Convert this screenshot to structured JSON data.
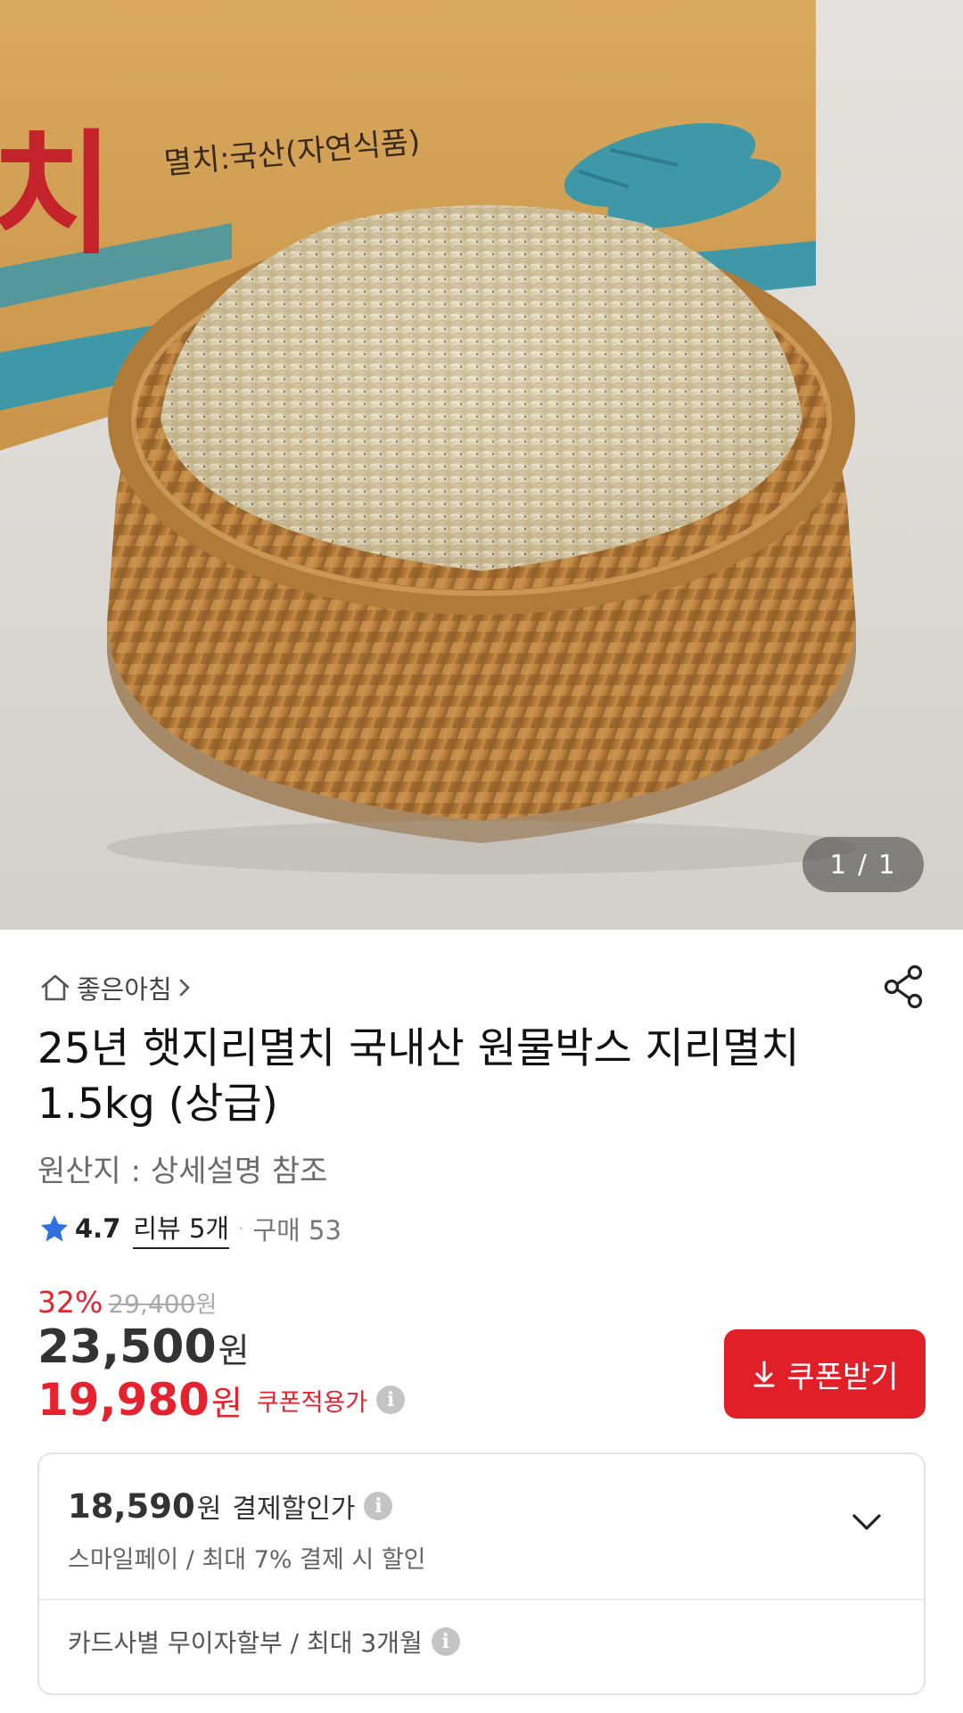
{
  "gallery": {
    "counter": "1 / 1",
    "box_text": "멸치:국산(자연식품)",
    "box_brand_fragment": "치"
  },
  "store": {
    "name": "좋은아침"
  },
  "product": {
    "title_line1": "25년 햇지리멸치 국내산 원물박스 지리멸치",
    "title_line2": "1.5kg (상급)",
    "origin": "원산지 : 상세설명 참조"
  },
  "rating": {
    "score": "4.7",
    "reviews": "리뷰 5개",
    "separator": "·",
    "purchases": "구매 53"
  },
  "price": {
    "discount_rate": "32%",
    "original": "29,400",
    "original_unit": "원",
    "sale": "23,500",
    "sale_unit": "원",
    "coupon_price": "19,980",
    "coupon_unit": "원",
    "coupon_label": "쿠폰적용가",
    "info_glyph": "i"
  },
  "coupon_button": {
    "label": "쿠폰받기"
  },
  "payment": {
    "price": "18,590",
    "unit": "원",
    "label": "결제할인가",
    "desc": "스마일페이 / 최대 7% 결제 시 할인",
    "installment": "카드사별 무이자할부 / 최대 3개월"
  },
  "colors": {
    "accent_red": "#e01f28",
    "price_red": "#e5232f",
    "star_blue": "#2f6fe0"
  }
}
